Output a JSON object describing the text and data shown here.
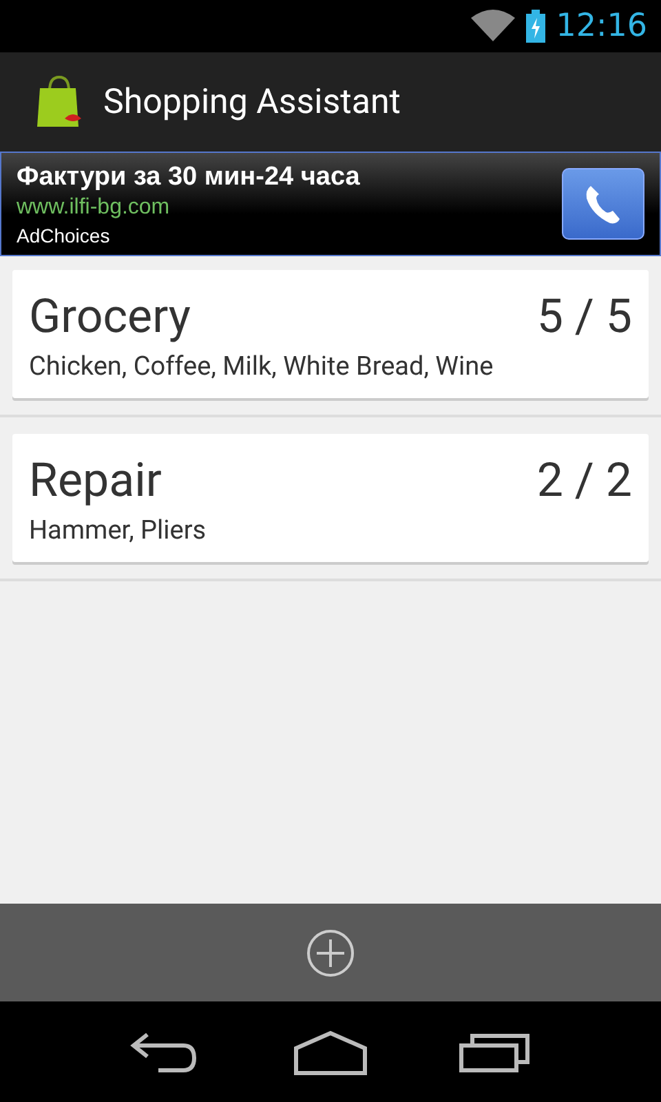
{
  "status_bar": {
    "time": "12:16"
  },
  "app_bar": {
    "title": "Shopping Assistant"
  },
  "ad": {
    "headline": "Фактури за 30 мин-24 часа",
    "url": "www.ilfi-bg.com",
    "adchoices": "AdChoices"
  },
  "lists": [
    {
      "name": "Grocery",
      "count": "5 / 5",
      "items": "Chicken, Coffee, Milk, White Bread, Wine"
    },
    {
      "name": "Repair",
      "count": "2 / 2",
      "items": "Hammer, Pliers"
    }
  ]
}
